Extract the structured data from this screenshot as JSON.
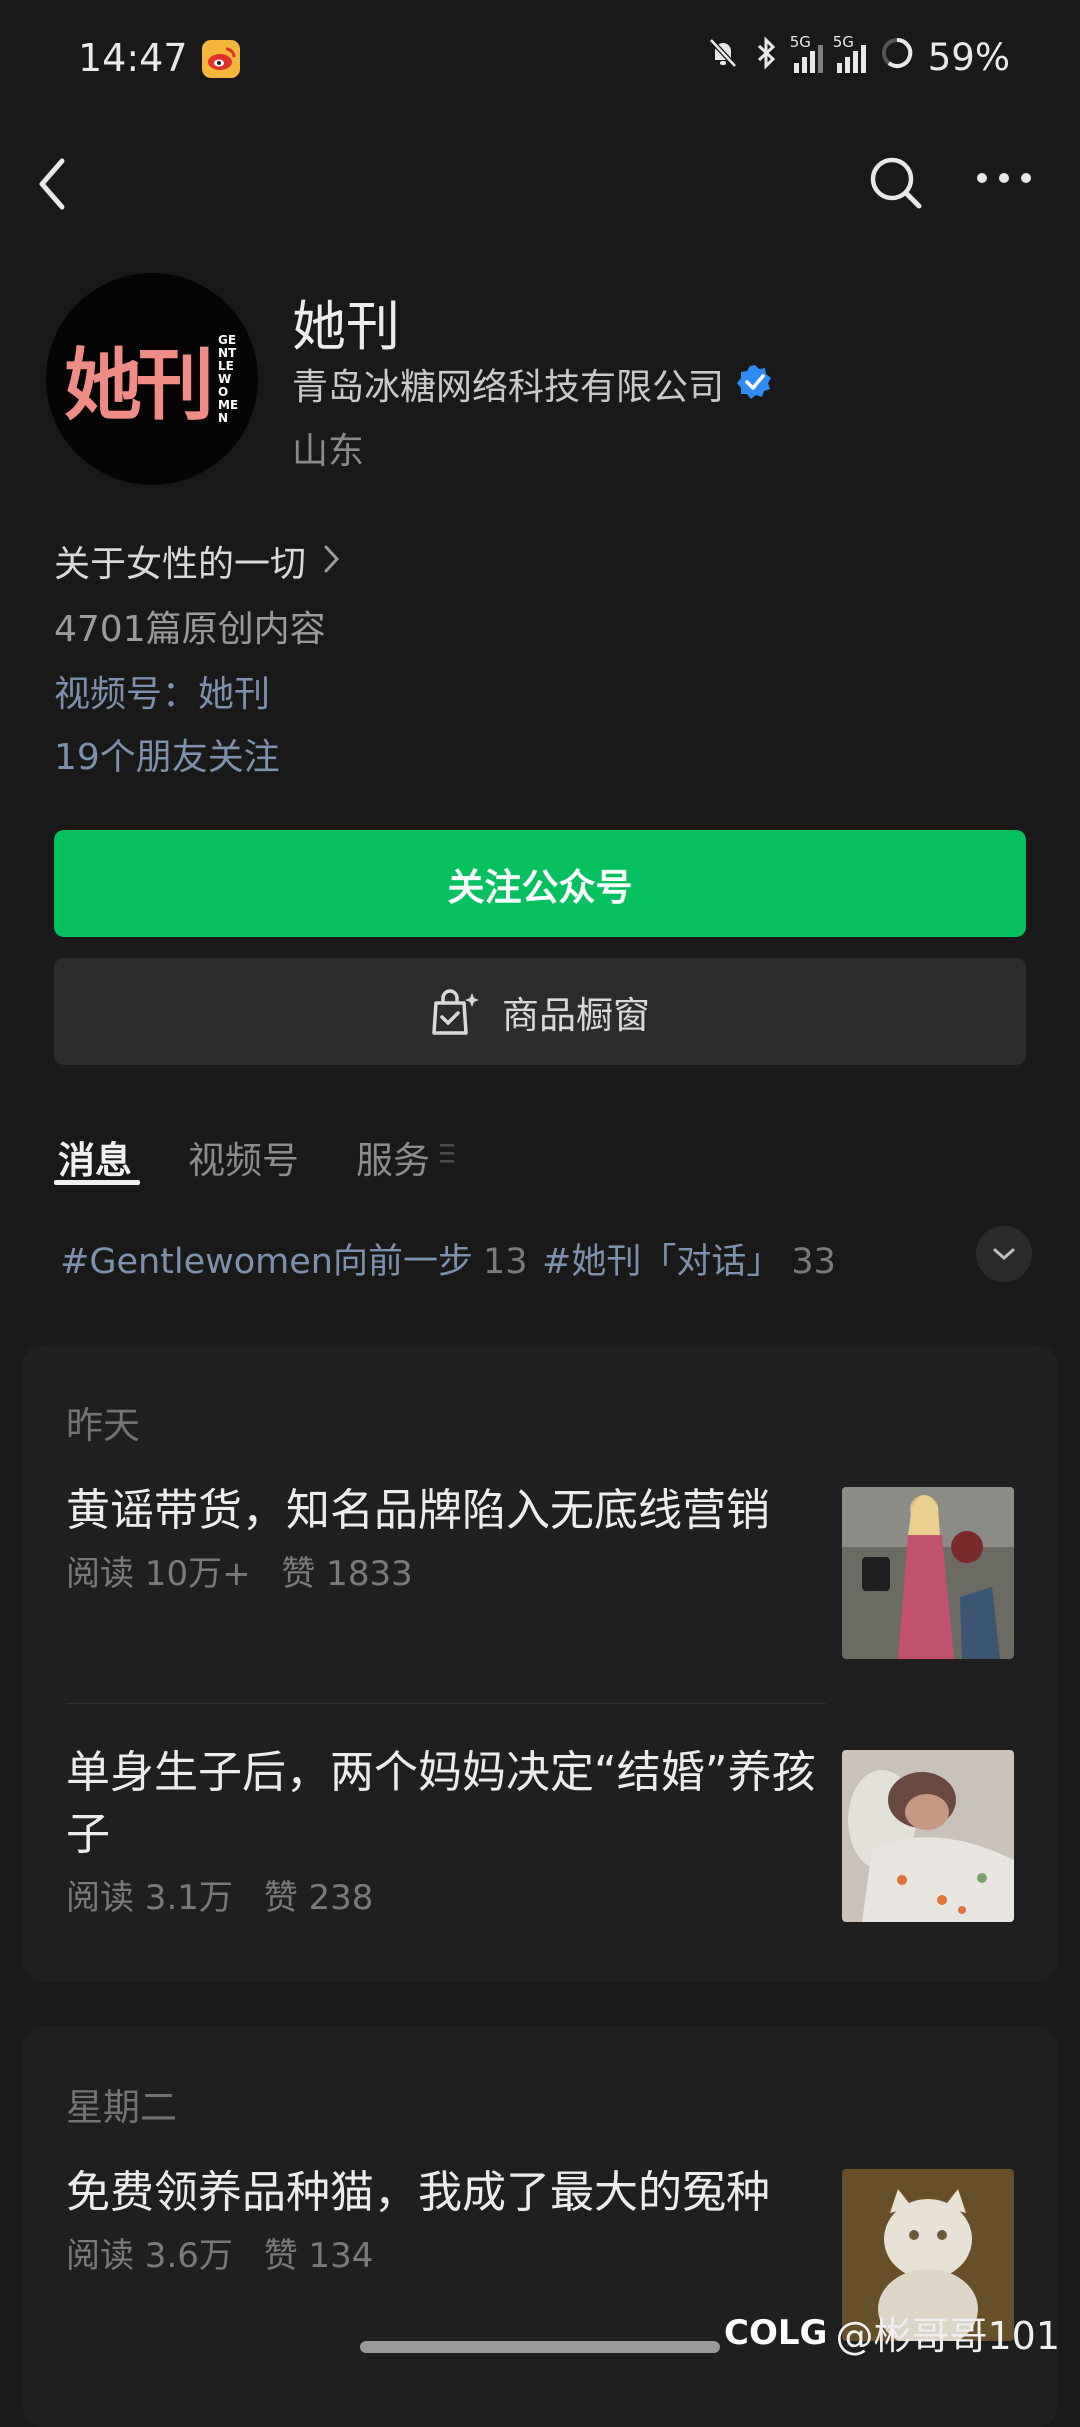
{
  "status_bar": {
    "time": "14:47",
    "network_1": "5G",
    "network_2": "5G",
    "battery": "59%"
  },
  "nav": {
    "back_icon": "back-arrow",
    "search_icon": "search",
    "more_icon": "more-dots"
  },
  "profile": {
    "name": "她刊",
    "company": "青岛冰糖网络科技有限公司",
    "region": "山东",
    "avatar_text": "她刊",
    "avatar_side_text": "GENTLEWOMEN",
    "bio": "关于女性的一切",
    "original_count": "4701篇原创内容",
    "channels": "视频号：她刊",
    "friends_follow": "19个朋友关注"
  },
  "buttons": {
    "follow": "关注公众号",
    "shop": "商品橱窗"
  },
  "tabs": [
    "消息",
    "视频号",
    "服务"
  ],
  "hashtags": [
    {
      "tag": "#Gentlewomen向前一步",
      "count": "13"
    },
    {
      "tag": "#她刊「对话」",
      "count": "33"
    }
  ],
  "groups": [
    {
      "day": "昨天",
      "articles": [
        {
          "title": "黄谣带货，知名品牌陷入无底线营销",
          "reads": "阅读 10万+",
          "likes": "赞 1833"
        },
        {
          "title": "单身生子后，两个妈妈决定“结婚”养孩子",
          "reads": "阅读 3.1万",
          "likes": "赞 238"
        }
      ]
    },
    {
      "day": "星期二",
      "articles": [
        {
          "title": "免费领养品种猫，我成了最大的冤种",
          "reads": "阅读 3.6万",
          "likes": "赞 134"
        }
      ]
    }
  ],
  "watermark": {
    "logo": "COLG",
    "handle": "@彬哥哥101"
  },
  "colors": {
    "accent_green": "#07c160",
    "link_blue": "#7d90ad",
    "verified_blue": "#2f8cf6"
  }
}
